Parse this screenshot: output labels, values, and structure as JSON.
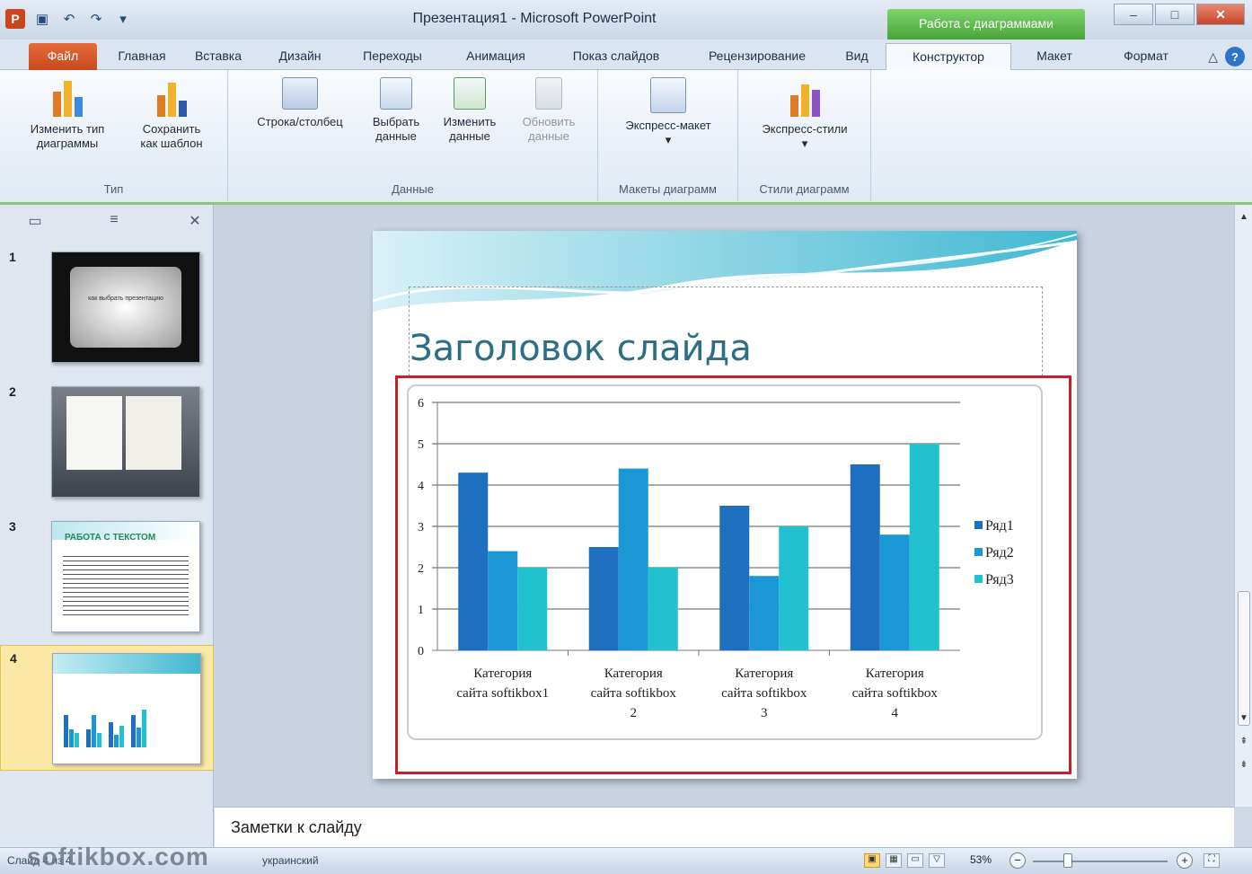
{
  "window": {
    "title": "Презентация1 - Microsoft PowerPoint",
    "context_title": "Работа с диаграммами",
    "min_icon": "minimize-icon",
    "max_icon": "maximize-icon",
    "close_icon": "close-icon"
  },
  "quick_access": [
    {
      "icon": "save-icon"
    },
    {
      "icon": "undo-icon"
    },
    {
      "icon": "redo-icon"
    }
  ],
  "tabs": [
    "Файл",
    "Главная",
    "Вставка",
    "Дизайн",
    "Переходы",
    "Анимация",
    "Показ слайдов",
    "Рецензирование",
    "Вид",
    "Конструктор",
    "Макет",
    "Формат"
  ],
  "active_tab": "Конструктор",
  "ribbon": {
    "groups": [
      {
        "label": "Тип",
        "buttons": [
          {
            "label1": "Изменить тип",
            "label2": "диаграммы",
            "icon": "change-chart-type-icon"
          },
          {
            "label1": "Сохранить",
            "label2": "как шаблон",
            "icon": "save-as-template-icon"
          }
        ]
      },
      {
        "label": "Данные",
        "buttons": [
          {
            "label1": "Строка/столбец",
            "label2": "",
            "icon": "switch-row-column-icon"
          },
          {
            "label1": "Выбрать",
            "label2": "данные",
            "icon": "select-data-icon"
          },
          {
            "label1": "Изменить",
            "label2": "данные",
            "icon": "edit-data-icon"
          },
          {
            "label1": "Обновить",
            "label2": "данные",
            "icon": "refresh-data-icon",
            "disabled": true
          }
        ]
      },
      {
        "label": "Макеты диаграмм",
        "buttons": [
          {
            "label1": "Экспресс-макет",
            "label2": "▾",
            "icon": "quick-layout-icon"
          }
        ]
      },
      {
        "label": "Стили диаграмм",
        "buttons": [
          {
            "label1": "Экспресс-стили",
            "label2": "▾",
            "icon": "quick-styles-icon"
          }
        ]
      }
    ]
  },
  "slides_panel": {
    "slides": [
      {
        "num": "1",
        "caption": "как выбрать презентацию"
      },
      {
        "num": "2",
        "caption": ""
      },
      {
        "num": "3",
        "caption": "РАБОТА С ТЕКСТОМ"
      },
      {
        "num": "4",
        "caption": "",
        "selected": true
      }
    ]
  },
  "slide": {
    "title": "Заголовок слайда"
  },
  "chart_data": {
    "type": "bar",
    "categories": [
      [
        "Категория",
        "сайта softikbox1"
      ],
      [
        "Категория",
        "сайта softikbox",
        "2"
      ],
      [
        "Категория",
        "сайта softikbox",
        "3"
      ],
      [
        "Категория",
        "сайта softikbox",
        "4"
      ]
    ],
    "series": [
      {
        "name": "Ряд1",
        "values": [
          4.3,
          2.5,
          3.5,
          4.5
        ],
        "color": "#1e6fc0"
      },
      {
        "name": "Ряд2",
        "values": [
          2.4,
          4.4,
          1.8,
          2.8
        ],
        "color": "#1a97d4"
      },
      {
        "name": "Ряд3",
        "values": [
          2.0,
          2.0,
          3.0,
          5.0
        ],
        "color": "#21c1cf"
      }
    ],
    "ylim": [
      0,
      6
    ],
    "yticks": [
      "0",
      "1",
      "2",
      "3",
      "4",
      "5",
      "6"
    ],
    "grid": true,
    "legend": "right"
  },
  "notes": {
    "placeholder": "Заметки к слайду"
  },
  "status": {
    "left": "Слайд 4 из 4",
    "lang": "украинский",
    "zoom": "53%",
    "watermark": "softikbox.com"
  }
}
